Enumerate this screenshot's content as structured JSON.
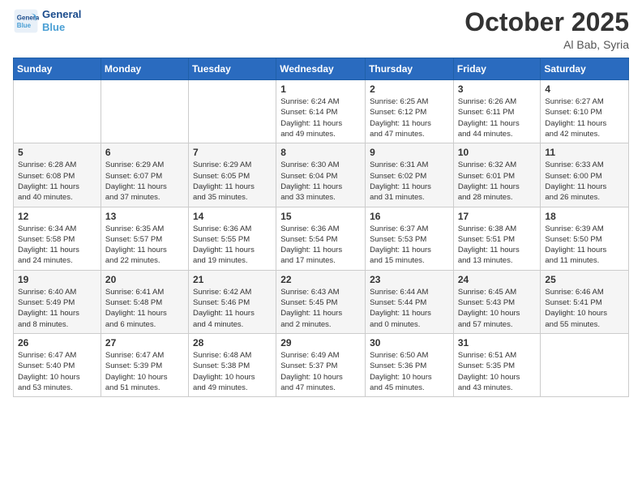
{
  "header": {
    "logo_line1": "General",
    "logo_line2": "Blue",
    "month_title": "October 2025",
    "location": "Al Bab, Syria"
  },
  "days_of_week": [
    "Sunday",
    "Monday",
    "Tuesday",
    "Wednesday",
    "Thursday",
    "Friday",
    "Saturday"
  ],
  "weeks": [
    [
      {
        "day": "",
        "content": ""
      },
      {
        "day": "",
        "content": ""
      },
      {
        "day": "",
        "content": ""
      },
      {
        "day": "1",
        "content": "Sunrise: 6:24 AM\nSunset: 6:14 PM\nDaylight: 11 hours\nand 49 minutes."
      },
      {
        "day": "2",
        "content": "Sunrise: 6:25 AM\nSunset: 6:12 PM\nDaylight: 11 hours\nand 47 minutes."
      },
      {
        "day": "3",
        "content": "Sunrise: 6:26 AM\nSunset: 6:11 PM\nDaylight: 11 hours\nand 44 minutes."
      },
      {
        "day": "4",
        "content": "Sunrise: 6:27 AM\nSunset: 6:10 PM\nDaylight: 11 hours\nand 42 minutes."
      }
    ],
    [
      {
        "day": "5",
        "content": "Sunrise: 6:28 AM\nSunset: 6:08 PM\nDaylight: 11 hours\nand 40 minutes."
      },
      {
        "day": "6",
        "content": "Sunrise: 6:29 AM\nSunset: 6:07 PM\nDaylight: 11 hours\nand 37 minutes."
      },
      {
        "day": "7",
        "content": "Sunrise: 6:29 AM\nSunset: 6:05 PM\nDaylight: 11 hours\nand 35 minutes."
      },
      {
        "day": "8",
        "content": "Sunrise: 6:30 AM\nSunset: 6:04 PM\nDaylight: 11 hours\nand 33 minutes."
      },
      {
        "day": "9",
        "content": "Sunrise: 6:31 AM\nSunset: 6:02 PM\nDaylight: 11 hours\nand 31 minutes."
      },
      {
        "day": "10",
        "content": "Sunrise: 6:32 AM\nSunset: 6:01 PM\nDaylight: 11 hours\nand 28 minutes."
      },
      {
        "day": "11",
        "content": "Sunrise: 6:33 AM\nSunset: 6:00 PM\nDaylight: 11 hours\nand 26 minutes."
      }
    ],
    [
      {
        "day": "12",
        "content": "Sunrise: 6:34 AM\nSunset: 5:58 PM\nDaylight: 11 hours\nand 24 minutes."
      },
      {
        "day": "13",
        "content": "Sunrise: 6:35 AM\nSunset: 5:57 PM\nDaylight: 11 hours\nand 22 minutes."
      },
      {
        "day": "14",
        "content": "Sunrise: 6:36 AM\nSunset: 5:55 PM\nDaylight: 11 hours\nand 19 minutes."
      },
      {
        "day": "15",
        "content": "Sunrise: 6:36 AM\nSunset: 5:54 PM\nDaylight: 11 hours\nand 17 minutes."
      },
      {
        "day": "16",
        "content": "Sunrise: 6:37 AM\nSunset: 5:53 PM\nDaylight: 11 hours\nand 15 minutes."
      },
      {
        "day": "17",
        "content": "Sunrise: 6:38 AM\nSunset: 5:51 PM\nDaylight: 11 hours\nand 13 minutes."
      },
      {
        "day": "18",
        "content": "Sunrise: 6:39 AM\nSunset: 5:50 PM\nDaylight: 11 hours\nand 11 minutes."
      }
    ],
    [
      {
        "day": "19",
        "content": "Sunrise: 6:40 AM\nSunset: 5:49 PM\nDaylight: 11 hours\nand 8 minutes."
      },
      {
        "day": "20",
        "content": "Sunrise: 6:41 AM\nSunset: 5:48 PM\nDaylight: 11 hours\nand 6 minutes."
      },
      {
        "day": "21",
        "content": "Sunrise: 6:42 AM\nSunset: 5:46 PM\nDaylight: 11 hours\nand 4 minutes."
      },
      {
        "day": "22",
        "content": "Sunrise: 6:43 AM\nSunset: 5:45 PM\nDaylight: 11 hours\nand 2 minutes."
      },
      {
        "day": "23",
        "content": "Sunrise: 6:44 AM\nSunset: 5:44 PM\nDaylight: 11 hours\nand 0 minutes."
      },
      {
        "day": "24",
        "content": "Sunrise: 6:45 AM\nSunset: 5:43 PM\nDaylight: 10 hours\nand 57 minutes."
      },
      {
        "day": "25",
        "content": "Sunrise: 6:46 AM\nSunset: 5:41 PM\nDaylight: 10 hours\nand 55 minutes."
      }
    ],
    [
      {
        "day": "26",
        "content": "Sunrise: 6:47 AM\nSunset: 5:40 PM\nDaylight: 10 hours\nand 53 minutes."
      },
      {
        "day": "27",
        "content": "Sunrise: 6:47 AM\nSunset: 5:39 PM\nDaylight: 10 hours\nand 51 minutes."
      },
      {
        "day": "28",
        "content": "Sunrise: 6:48 AM\nSunset: 5:38 PM\nDaylight: 10 hours\nand 49 minutes."
      },
      {
        "day": "29",
        "content": "Sunrise: 6:49 AM\nSunset: 5:37 PM\nDaylight: 10 hours\nand 47 minutes."
      },
      {
        "day": "30",
        "content": "Sunrise: 6:50 AM\nSunset: 5:36 PM\nDaylight: 10 hours\nand 45 minutes."
      },
      {
        "day": "31",
        "content": "Sunrise: 6:51 AM\nSunset: 5:35 PM\nDaylight: 10 hours\nand 43 minutes."
      },
      {
        "day": "",
        "content": ""
      }
    ]
  ]
}
